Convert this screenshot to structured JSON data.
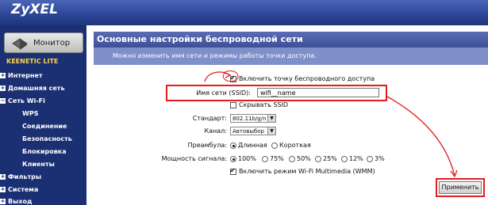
{
  "header": {
    "logo": "ZyXEL"
  },
  "sidebar": {
    "monitor": "Монитор",
    "brand": "KEENETIC LITE",
    "items": [
      {
        "label": "Интернет"
      },
      {
        "label": "Домашняя сеть"
      },
      {
        "label": "Сеть Wi-Fi"
      },
      {
        "label": "Фильтры"
      },
      {
        "label": "Система"
      },
      {
        "label": "Выход"
      }
    ],
    "wifi_sub": [
      "WPS",
      "Соединение",
      "Безопасность",
      "Блокировка",
      "Клиенты"
    ]
  },
  "main": {
    "title": "Основные настройки беспроводной сети",
    "description": "Можно изменить имя сети и режимы работы точки доступа.",
    "enable_ap": {
      "label": "Включить точку беспроводного доступа",
      "checked": true
    },
    "ssid": {
      "label": "Имя сети (SSID):",
      "value": "wifi__name"
    },
    "hide_ssid": {
      "label": "Скрывать SSID",
      "checked": false
    },
    "standard": {
      "label": "Стандарт:",
      "value": "802.11b/g/n"
    },
    "channel": {
      "label": "Канал:",
      "value": "Автовыбор"
    },
    "preamble": {
      "label": "Преамбула:",
      "options": [
        "Длинная",
        "Короткая"
      ],
      "selected": "Длинная"
    },
    "power": {
      "label": "Мощность сигнала:",
      "options": [
        "100%",
        "75%",
        "50%",
        "25%",
        "12%",
        "3%"
      ],
      "selected": "100%"
    },
    "wmm": {
      "label": "Включить режим Wi-Fi Multimedia (WMM)",
      "checked": true
    },
    "apply": "Применить"
  },
  "colors": {
    "header": "#2c4696",
    "sidebar": "#1b2f73",
    "accent_text": "#ffd34a",
    "annotation": "#e01e1e"
  }
}
